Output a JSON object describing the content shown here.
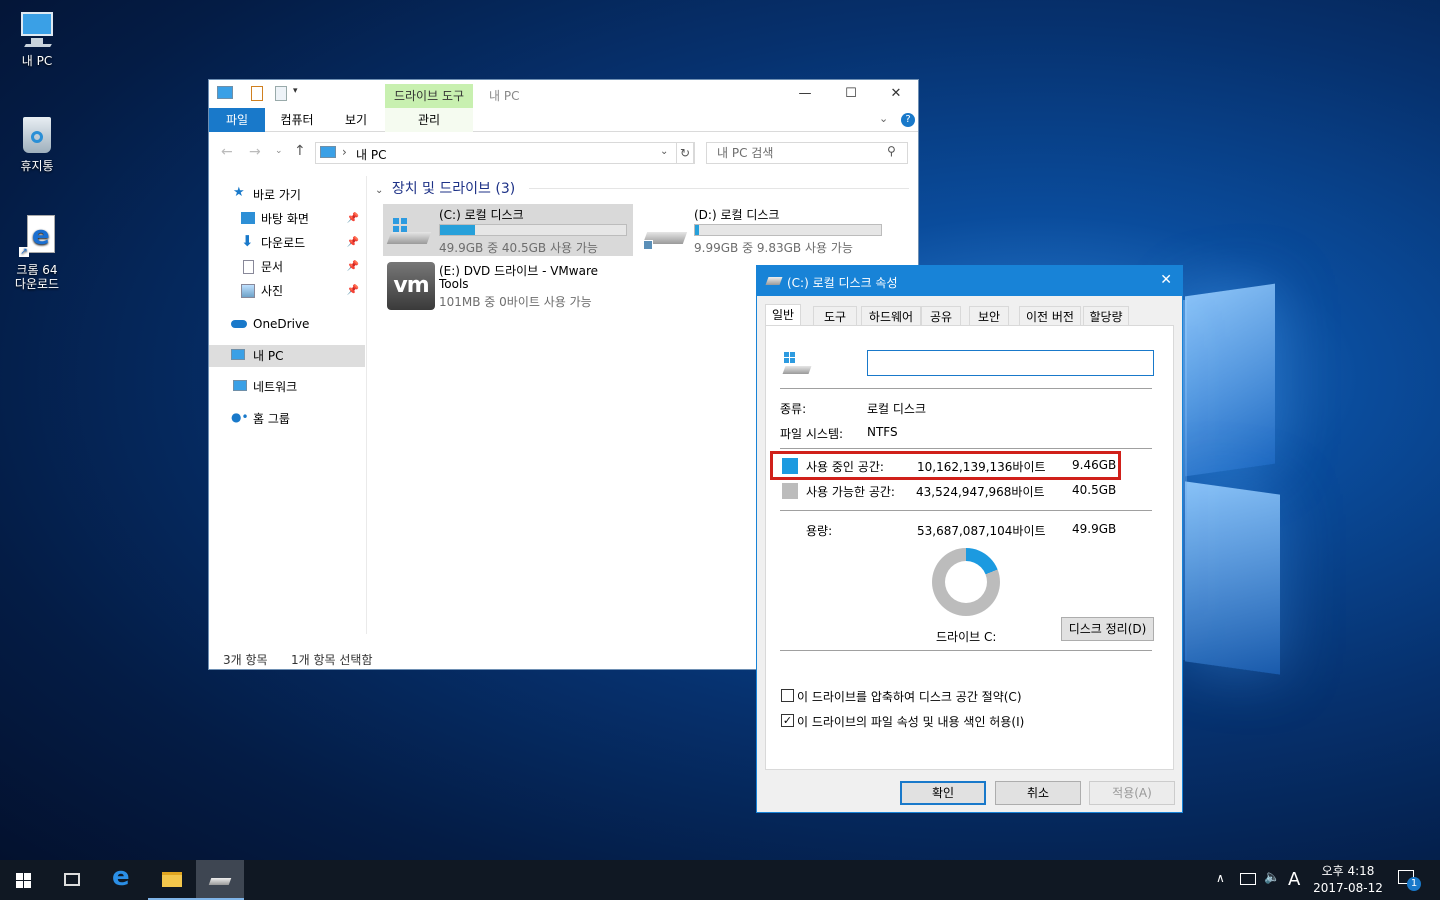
{
  "desktop": {
    "icons": [
      {
        "label": "내 PC"
      },
      {
        "label": "휴지통"
      },
      {
        "label_line1": "크롬 64",
        "label_line2": "다운로드"
      }
    ]
  },
  "explorer": {
    "title": "내 PC",
    "context_tab": "드라이브 도구",
    "tabs": [
      "파일",
      "컴퓨터",
      "보기",
      "관리"
    ],
    "address": "내 PC",
    "search_placeholder": "내 PC 검색",
    "nav": {
      "quick_access": "바로 가기",
      "items": [
        "바탕 화면",
        "다운로드",
        "문서",
        "사진"
      ],
      "onedrive": "OneDrive",
      "this_pc": "내 PC",
      "network": "네트워크",
      "homegroup": "홈 그룹"
    },
    "group_header": "장치 및 드라이브 (3)",
    "drives": [
      {
        "name": "(C:) 로컬 디스크",
        "detail": "49.9GB 중 40.5GB 사용 가능",
        "used_fraction": 0.19
      },
      {
        "name": "(D:) 로컬 디스크",
        "detail": "9.99GB 중 9.83GB 사용 가능",
        "used_fraction": 0.02
      },
      {
        "name_line1": "(E:) DVD 드라이브 - VMware",
        "name_line2": "Tools",
        "detail": "101MB 중 0바이트 사용 가능",
        "logo": "vm"
      }
    ],
    "status": {
      "count": "3개 항목",
      "selected": "1개 항목 선택함"
    }
  },
  "dialog": {
    "title": "(C:) 로컬 디스크 속성",
    "tabs": [
      "일반",
      "도구",
      "하드웨어",
      "공유",
      "보안",
      "이전 버전",
      "할당량"
    ],
    "label_value": "",
    "type_label": "종류:",
    "type_value": "로컬 디스크",
    "fs_label": "파일 시스템:",
    "fs_value": "NTFS",
    "used_label": "사용 중인 공간:",
    "used_bytes": "10,162,139,136바이트",
    "used_gb": "9.46GB",
    "free_label": "사용 가능한 공간:",
    "free_bytes": "43,524,947,968바이트",
    "free_gb": "40.5GB",
    "cap_label": "용량:",
    "cap_bytes": "53,687,087,104바이트",
    "cap_gb": "49.9GB",
    "used_fraction": 0.19,
    "drive_label": "드라이브 C:",
    "cleanup_button": "디스크 정리(D)",
    "compress_option": "이 드라이브를 압축하여 디스크 공간 절약(C)",
    "compress_checked": false,
    "index_option": "이 드라이브의 파일 속성 및 내용 색인 허용(I)",
    "index_checked": true,
    "ok": "확인",
    "cancel": "취소",
    "apply": "적용(A)",
    "colors": {
      "used": "#1c9ae0",
      "free": "#bcbcbc",
      "highlight": "#d0201a"
    }
  },
  "taskbar": {
    "clock_time": "오후 4:18",
    "clock_date": "2017-08-12",
    "ime": "A",
    "notification_count": "1"
  }
}
